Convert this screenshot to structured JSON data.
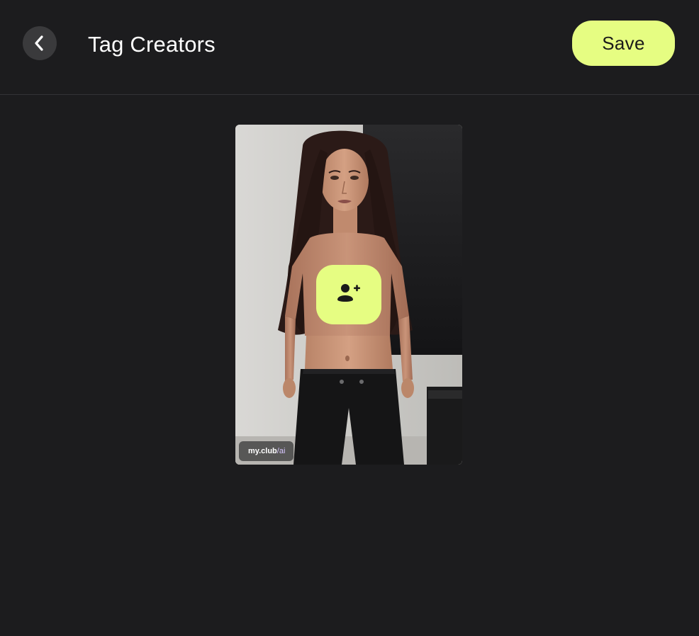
{
  "header": {
    "title": "Tag Creators",
    "save_label": "Save",
    "back_icon": "chevron-left-icon"
  },
  "media": {
    "tag_button_icon": "add-person-icon",
    "watermark": {
      "prefix": "my.",
      "middle": "club",
      "suffix": "/ai"
    }
  },
  "colors": {
    "background": "#1c1c1e",
    "accent": "#e6fd82",
    "back_button": "#3a3a3c"
  }
}
